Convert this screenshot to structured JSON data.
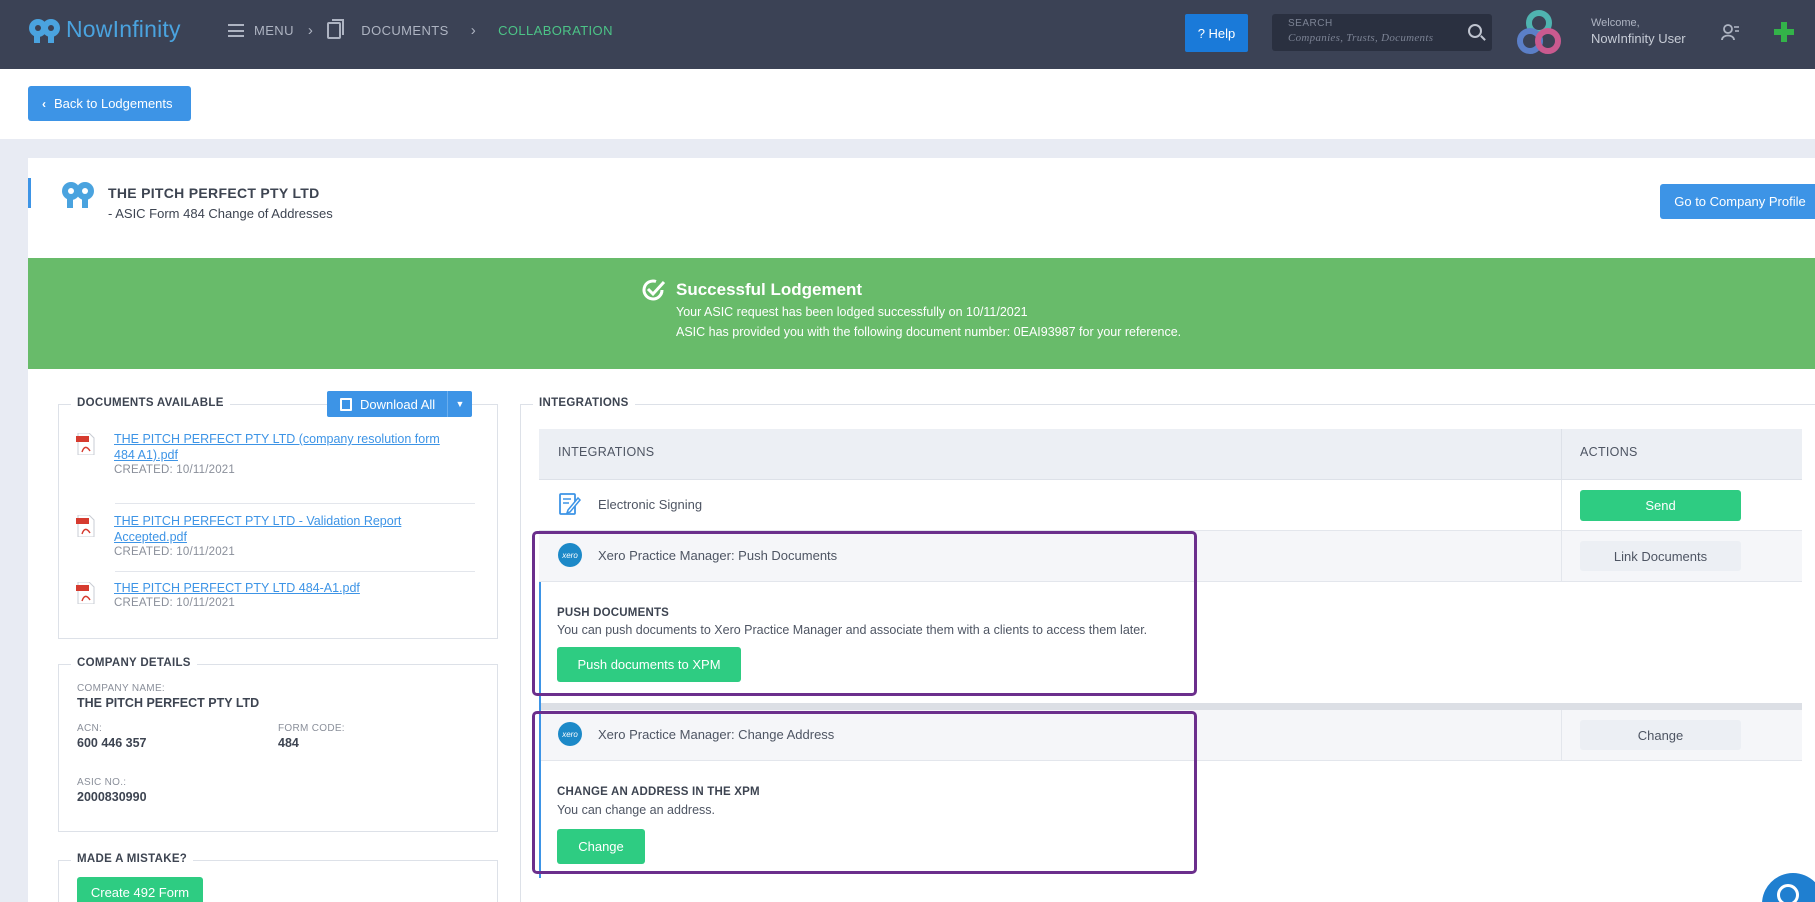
{
  "header": {
    "logo_text_1": "Now",
    "logo_text_2": "Infinity",
    "menu_label": "MENU",
    "documents_label": "DOCUMENTS",
    "collaboration_label": "COLLABORATION",
    "help_label": "? Help",
    "search_label": "SEARCH",
    "search_placeholder": "Companies,  Trusts,  Documents",
    "welcome_label": "Welcome,",
    "user_name": "NowInfinity User"
  },
  "back_button_label": "Back to Lodgements",
  "company": {
    "name": "THE PITCH PERFECT PTY LTD",
    "form": "- ASIC Form 484 Change of Addresses",
    "profile_button_label": "Go to Company Profile"
  },
  "success": {
    "title": "Successful Lodgement",
    "line1": "Your ASIC request has been lodged successfully on 10/11/2021",
    "line2": "ASIC has provided you with the following document number: 0EAI93987 for your reference."
  },
  "documents": {
    "legend": "DOCUMENTS AVAILABLE",
    "download_all_label": "Download All",
    "items": [
      {
        "name": "THE PITCH PERFECT PTY LTD (company resolution form 484 A1).pdf",
        "created": "CREATED: 10/11/2021"
      },
      {
        "name": "THE PITCH PERFECT PTY LTD - Validation Report Accepted.pdf",
        "created": "CREATED: 10/11/2021"
      },
      {
        "name": "THE PITCH PERFECT PTY LTD 484-A1.pdf",
        "created": "CREATED: 10/11/2021"
      }
    ]
  },
  "company_details": {
    "legend": "COMPANY DETAILS",
    "company_name_label": "COMPANY NAME:",
    "company_name": "THE PITCH PERFECT PTY LTD",
    "acn_label": "ACN:",
    "acn": "600 446 357",
    "form_code_label": "FORM CODE:",
    "form_code": "484",
    "asic_no_label": "ASIC NO.:",
    "asic_no": "2000830990"
  },
  "mistake": {
    "legend": "MADE A MISTAKE?",
    "create_button_label": "Create 492 Form"
  },
  "integrations": {
    "legend": "INTEGRATIONS",
    "col_integrations": "INTEGRATIONS",
    "col_actions": "ACTIONS",
    "rows": [
      {
        "label": "Electronic Signing",
        "action": "Send"
      },
      {
        "label": "Xero Practice Manager: Push Documents",
        "action": "Link Documents"
      },
      {
        "label": "Xero Practice Manager: Change Address",
        "action": "Change"
      }
    ],
    "xero_logo_text": "xero",
    "push": {
      "heading": "PUSH DOCUMENTS",
      "text": "You can push documents to Xero Practice Manager and associate them with a clients to access them later.",
      "button_label": "Push documents to XPM"
    },
    "change": {
      "heading": "CHANGE AN ADDRESS IN THE XPM",
      "text": "You can change an address.",
      "button_label": "Change"
    }
  },
  "colors": {
    "topbar": "#3b4255",
    "accent_blue": "#3d94e6",
    "success_green": "#68bb6a",
    "button_green": "#2ecc82",
    "highlight_purple": "#6b2f8c"
  }
}
